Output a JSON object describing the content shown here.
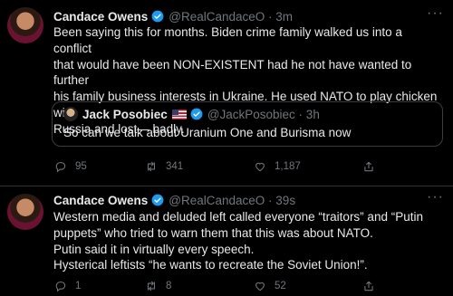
{
  "tweets": [
    {
      "author": "Candace Owens",
      "handle": "@RealCandaceO · 3m",
      "text_lines": [
        "Been saying this for months. Biden crime family walked us into a conflict",
        "that would have been NON-EXISTENT had he not have wanted to further",
        "his family business interests in Ukraine. He used NATO to play chicken with",
        "Russia and lost— badly."
      ],
      "quote": {
        "author": "Jack Posobiec",
        "handle": "@JackPosobiec · 3h",
        "text": "So can we talk about Uranium One and Burisma now"
      },
      "actions": {
        "replies": "95",
        "retweets": "341",
        "likes": "1,187"
      }
    },
    {
      "author": "Candace Owens",
      "handle": "@RealCandaceO · 39s",
      "text_lines": [
        "Western media and deluded left called everyone “traitors” and “Putin",
        "puppets” who tried to warn them that this was about NATO.",
        "Putin said it in virtually every speech.",
        "Hysterical leftists “he wants to recreate the Soviet Union!”."
      ],
      "actions": {
        "replies": "1",
        "retweets": "8",
        "likes": "52"
      }
    }
  ],
  "icons": {
    "more": "more-horizontal-icon",
    "verified": "verified-badge-icon",
    "reply": "reply-icon",
    "retweet": "retweet-icon",
    "like": "heart-icon",
    "share": "share-icon"
  },
  "colors": {
    "background": "#000000",
    "text": "#e7e9ea",
    "muted": "#71767b",
    "verified": "#1d9bf0"
  }
}
